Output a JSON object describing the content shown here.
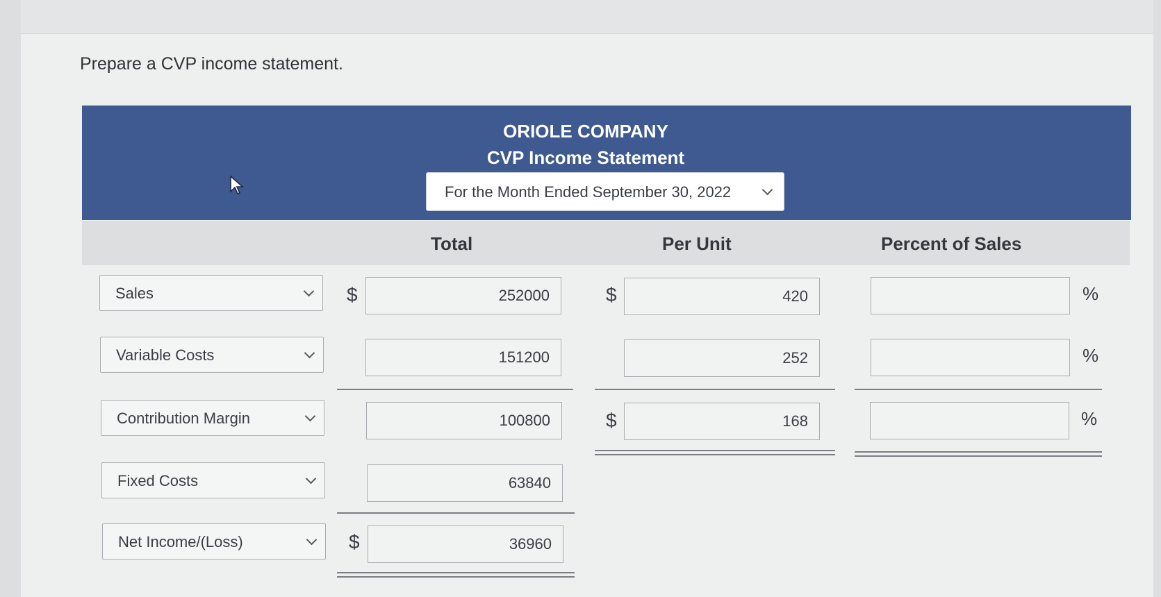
{
  "instruction": "Prepare a CVP income statement.",
  "header": {
    "company": "ORIOLE COMPANY",
    "title": "CVP Income Statement",
    "period": "For the Month Ended September 30, 2022"
  },
  "columns": {
    "total": "Total",
    "per_unit": "Per Unit",
    "percent": "Percent of Sales"
  },
  "symbols": {
    "dollar": "$",
    "percent": "%"
  },
  "rows": [
    {
      "label": "Sales",
      "total": "252000",
      "per_unit": "420",
      "percent": ""
    },
    {
      "label": "Variable Costs",
      "total": "151200",
      "per_unit": "252",
      "percent": ""
    },
    {
      "label": "Contribution Margin",
      "total": "100800",
      "per_unit": "168",
      "percent": ""
    },
    {
      "label": "Fixed Costs",
      "total": "63840"
    },
    {
      "label": "Net Income/(Loss)",
      "total": "36960"
    }
  ],
  "icons": {
    "cursor": "mouse-pointer-icon",
    "dropdown": "chevron-down-icon"
  }
}
